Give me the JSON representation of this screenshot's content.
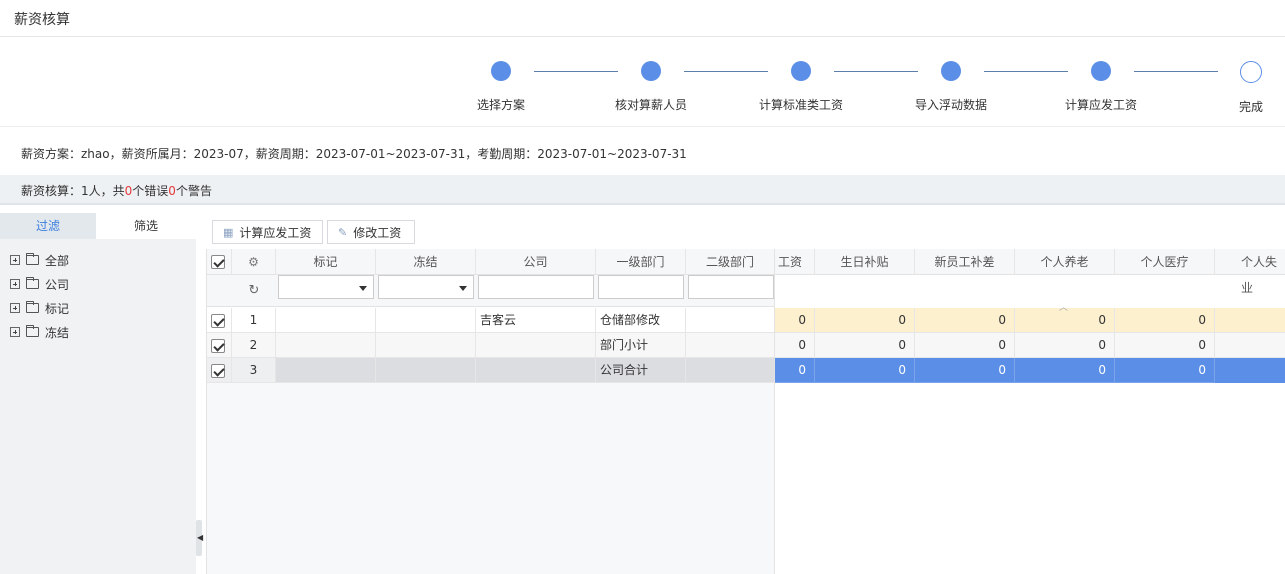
{
  "header": {
    "title": "薪资核算"
  },
  "steps": [
    {
      "label": "选择方案",
      "done": true
    },
    {
      "label": "核对算薪人员",
      "done": true
    },
    {
      "label": "计算标准类工资",
      "done": true
    },
    {
      "label": "导入浮动数据",
      "done": true
    },
    {
      "label": "计算应发工资",
      "done": true
    },
    {
      "label": "完成",
      "done": false
    }
  ],
  "info": {
    "text": "薪资方案：zhao，薪资所属月：2023-07，薪资周期：2023-07-01~2023-07-31，考勤周期：2023-07-01~2023-07-31"
  },
  "summary": {
    "prefix": "薪资核算：1人，共",
    "errors": "0",
    "mid": "个错误",
    "warnings": "0",
    "suffix": "个警告"
  },
  "left_panel": {
    "tabs": {
      "filter": "过滤",
      "select": "筛选"
    },
    "tree": [
      "全部",
      "公司",
      "标记",
      "冻结"
    ]
  },
  "toolbar": {
    "calc_label": "计算应发工资",
    "edit_label": "修改工资"
  },
  "grid": {
    "fixed_headers": [
      "标记",
      "冻结",
      "公司",
      "一级部门",
      "二级部门"
    ],
    "scroll_headers": [
      "工资",
      "生日补贴",
      "新员工补差",
      "个人养老",
      "个人医疗",
      "个人失业"
    ],
    "rows": [
      {
        "no": "1",
        "company": "吉客云",
        "dept1": "仓储部修改",
        "values": [
          "0",
          "0",
          "0",
          "0",
          "0",
          ""
        ]
      },
      {
        "no": "2",
        "company": "",
        "dept1": "部门小计",
        "values": [
          "0",
          "0",
          "0",
          "0",
          "0",
          ""
        ]
      },
      {
        "no": "3",
        "company": "",
        "dept1": "公司合计",
        "values": [
          "0",
          "0",
          "0",
          "0",
          "0",
          ""
        ]
      }
    ]
  },
  "colors": {
    "accent": "#5b8ee6",
    "selected_row": "#5b8ee6",
    "highlight_row": "#fdf0cf",
    "error_red": "#e4393c"
  }
}
